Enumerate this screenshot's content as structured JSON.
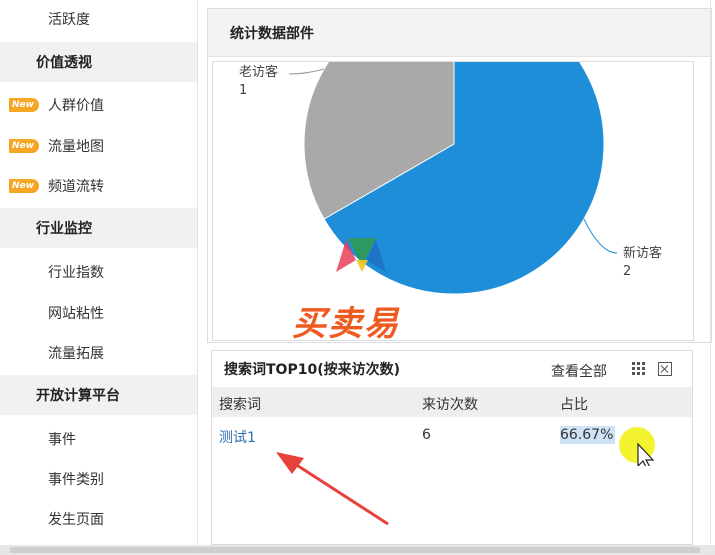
{
  "sidebar": {
    "items": [
      {
        "label": "活跃度"
      },
      {
        "label": "价值透视"
      },
      {
        "label": "人群价值",
        "badge": "New"
      },
      {
        "label": "流量地图",
        "badge": "New"
      },
      {
        "label": "频道流转",
        "badge": "New"
      },
      {
        "label": "行业监控"
      },
      {
        "label": "行业指数"
      },
      {
        "label": "网站粘性"
      },
      {
        "label": "流量拓展"
      },
      {
        "label": "开放计算平台"
      },
      {
        "label": "事件"
      },
      {
        "label": "事件类别"
      },
      {
        "label": "发生页面"
      }
    ]
  },
  "stats_panel": {
    "title": "统计数据部件"
  },
  "chart_data": {
    "type": "pie",
    "title": "",
    "slices": [
      {
        "label": "新访客",
        "value": 2,
        "color": "#1e8ed9"
      },
      {
        "label": "老访客",
        "value": 1,
        "color": "#a9a9a9"
      }
    ]
  },
  "search_panel": {
    "title": "搜索词TOP10(按来访次数)",
    "view_all": "查看全部",
    "columns": [
      "搜索词",
      "来访次数",
      "占比"
    ],
    "rows": [
      {
        "term": "测试1",
        "visits": "6",
        "share": "66.67%"
      }
    ]
  },
  "watermark": "买卖易",
  "colors": {
    "accent": "#1e8ed9",
    "badge": "#f5a623",
    "link": "#2a6fb3",
    "annotation_arrow": "#e8403a"
  }
}
